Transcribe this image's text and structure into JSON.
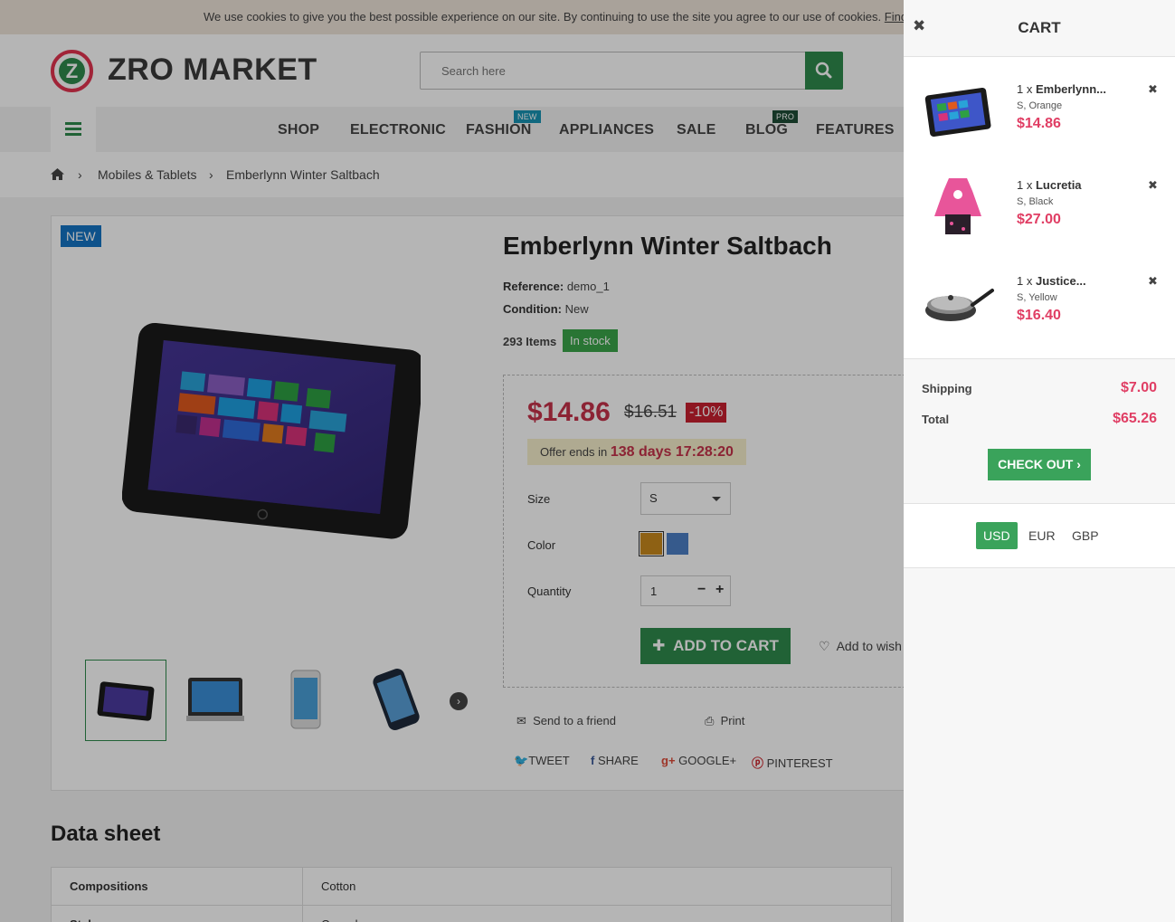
{
  "cookie_bar": {
    "text": "We use cookies to give you the best possible experience on our site. By continuing to use the site you agree to our use of cookies.",
    "link": "Find"
  },
  "header": {
    "logo_letter": "Z",
    "logo_text": "ZRO MARKET",
    "search_placeholder": "Search here"
  },
  "nav": {
    "items": [
      {
        "label": "SHOP"
      },
      {
        "label": "ELECTRONIC"
      },
      {
        "label": "FASHION",
        "badge": "NEW"
      },
      {
        "label": "APPLIANCES"
      },
      {
        "label": "SALE"
      },
      {
        "label": "BLOG",
        "badge": "PRO"
      },
      {
        "label": "FEATURES"
      }
    ]
  },
  "breadcrumb": {
    "items": [
      "Mobiles & Tablets",
      "Emberlynn Winter Saltbach"
    ]
  },
  "product": {
    "tag": "NEW",
    "title": "Emberlynn Winter Saltbach",
    "reference_label": "Reference:",
    "reference": "demo_1",
    "condition_label": "Condition:",
    "condition": "New",
    "items_count": "293 Items",
    "stock": "In stock",
    "price": "$14.86",
    "old_price": "$16.51",
    "discount": "-10%",
    "offer_label": "Offer ends in",
    "offer_time": "138 days 17:28:20",
    "size_label": "Size",
    "size_value": "S",
    "color_label": "Color",
    "colors": [
      "#c8891d",
      "#4d7fc6"
    ],
    "quantity_label": "Quantity",
    "quantity": "1",
    "add_to_cart": "ADD TO CART",
    "wishlist": "Add to wish",
    "send_friend": "Send to a friend",
    "print": "Print",
    "share": {
      "tweet": "TWEET",
      "share": "SHARE",
      "google": "GOOGLE+",
      "pinterest": "PINTEREST"
    }
  },
  "datasheet": {
    "title": "Data sheet",
    "rows": [
      {
        "key": "Compositions",
        "value": "Cotton"
      },
      {
        "key": "Styles",
        "value": "Casual"
      }
    ]
  },
  "cart": {
    "title": "CART",
    "items": [
      {
        "qty": "1 x",
        "name": "Emberlynn...",
        "attrs": "S, Orange",
        "price": "$14.86",
        "icon": "tablet-image"
      },
      {
        "qty": "1 x",
        "name": "Lucretia",
        "attrs": "S, Black",
        "price": "$27.00",
        "icon": "dress-image"
      },
      {
        "qty": "1 x",
        "name": "Justice...",
        "attrs": "S, Yellow",
        "price": "$16.40",
        "icon": "pan-image"
      }
    ],
    "shipping_label": "Shipping",
    "shipping": "$7.00",
    "total_label": "Total",
    "total": "$65.26",
    "checkout": "CHECK OUT",
    "currencies": [
      "USD",
      "EUR",
      "GBP"
    ],
    "active_currency": "USD"
  },
  "colors": {
    "brand_green": "#2f8a4c",
    "price_red": "#c5324a",
    "cart_price": "#e03e64"
  }
}
